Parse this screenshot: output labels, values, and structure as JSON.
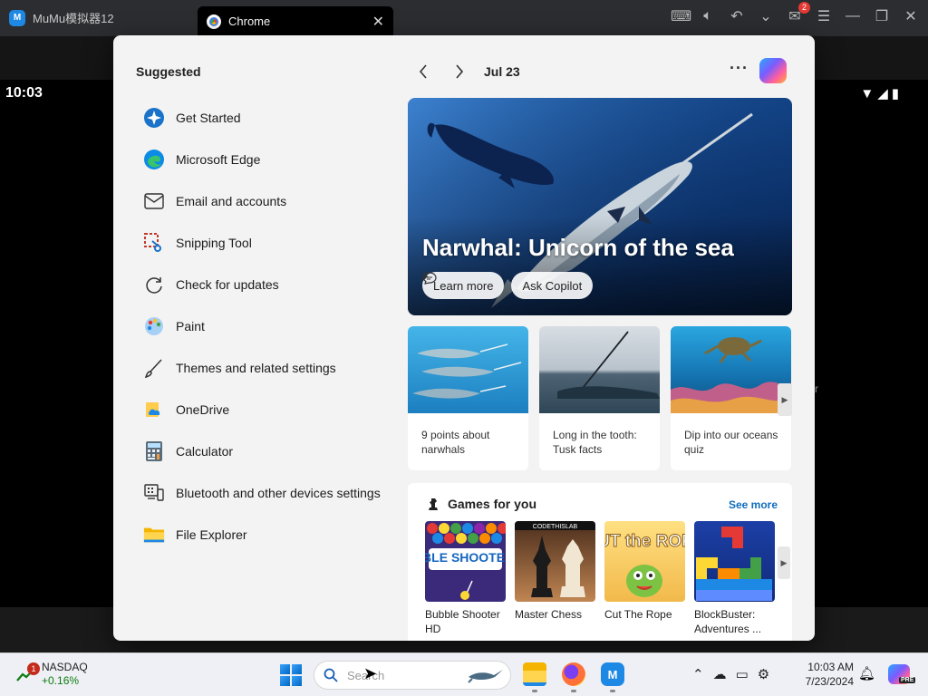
{
  "emulator": {
    "app_title": "MuMu模拟器12",
    "tab_label": "Chrome",
    "mail_badge": "2"
  },
  "android": {
    "time": "10:03",
    "edge_text": "r"
  },
  "widgets": {
    "suggested_title": "Suggested",
    "suggested": [
      {
        "label": "Get Started",
        "icon": "get-started-icon"
      },
      {
        "label": "Microsoft Edge",
        "icon": "edge-icon"
      },
      {
        "label": "Email and accounts",
        "icon": "mail-icon"
      },
      {
        "label": "Snipping Tool",
        "icon": "scissors-icon"
      },
      {
        "label": "Check for updates",
        "icon": "refresh-icon"
      },
      {
        "label": "Paint",
        "icon": "paint-icon"
      },
      {
        "label": "Themes and related settings",
        "icon": "brush-icon"
      },
      {
        "label": "OneDrive",
        "icon": "onedrive-icon"
      },
      {
        "label": "Calculator",
        "icon": "calculator-icon"
      },
      {
        "label": "Bluetooth and other devices settings",
        "icon": "devices-icon"
      },
      {
        "label": "File Explorer",
        "icon": "folder-icon"
      }
    ],
    "date": "Jul 23",
    "hero": {
      "title": "Narwhal: Unicorn of the sea",
      "learn_more": "Learn more",
      "ask_copilot": "Ask Copilot"
    },
    "cards": [
      {
        "text": "9 points about narwhals"
      },
      {
        "text": "Long in the tooth: Tusk facts"
      },
      {
        "text": "Dip into our oceans quiz"
      }
    ],
    "games": {
      "title": "Games for you",
      "see_more": "See more",
      "items": [
        {
          "name": "Bubble Shooter HD",
          "thumb_text": "BUBBLE SHOOTER HD"
        },
        {
          "name": "Master Chess",
          "thumb_text": "CODETHISLAB"
        },
        {
          "name": "Cut The Rope",
          "thumb_text": "CUT the ROPE"
        },
        {
          "name": "BlockBuster: Adventures ...",
          "thumb_text": ""
        }
      ]
    }
  },
  "taskbar": {
    "stock_name": "NASDAQ",
    "stock_change": "+0.16%",
    "stock_badge": "1",
    "search_placeholder": "Search",
    "time": "10:03 AM",
    "date": "7/23/2024",
    "copilot_badge": "PRE"
  },
  "colors": {
    "accent": "#0f6cbd",
    "panel_bg": "#f3f3f3",
    "stock_green": "#0f7b0f"
  }
}
